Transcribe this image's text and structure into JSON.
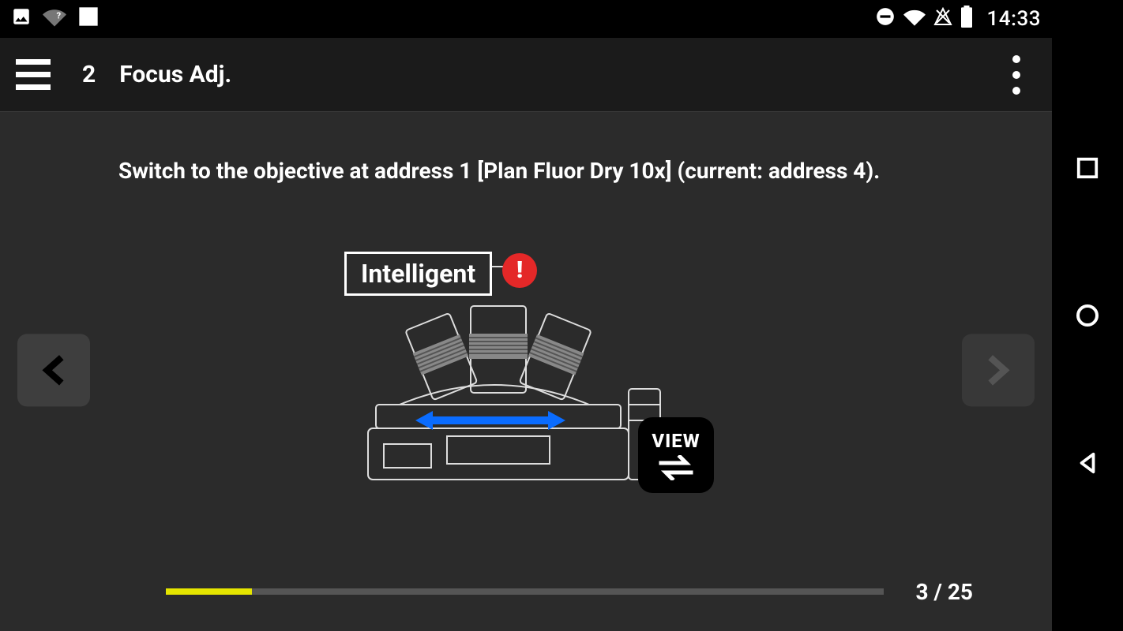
{
  "status_bar": {
    "time": "14:33"
  },
  "header": {
    "step_number": "2",
    "title": "Focus Adj."
  },
  "content": {
    "instruction": "Switch to the objective at address 1 [Plan Fluor Dry 10x] (current: address 4).",
    "label": "Intelligent",
    "view_button": "VIEW"
  },
  "footer": {
    "current_step": 3,
    "total_steps": 25,
    "counter_text": "3 / 25",
    "progress_percent": 12
  }
}
